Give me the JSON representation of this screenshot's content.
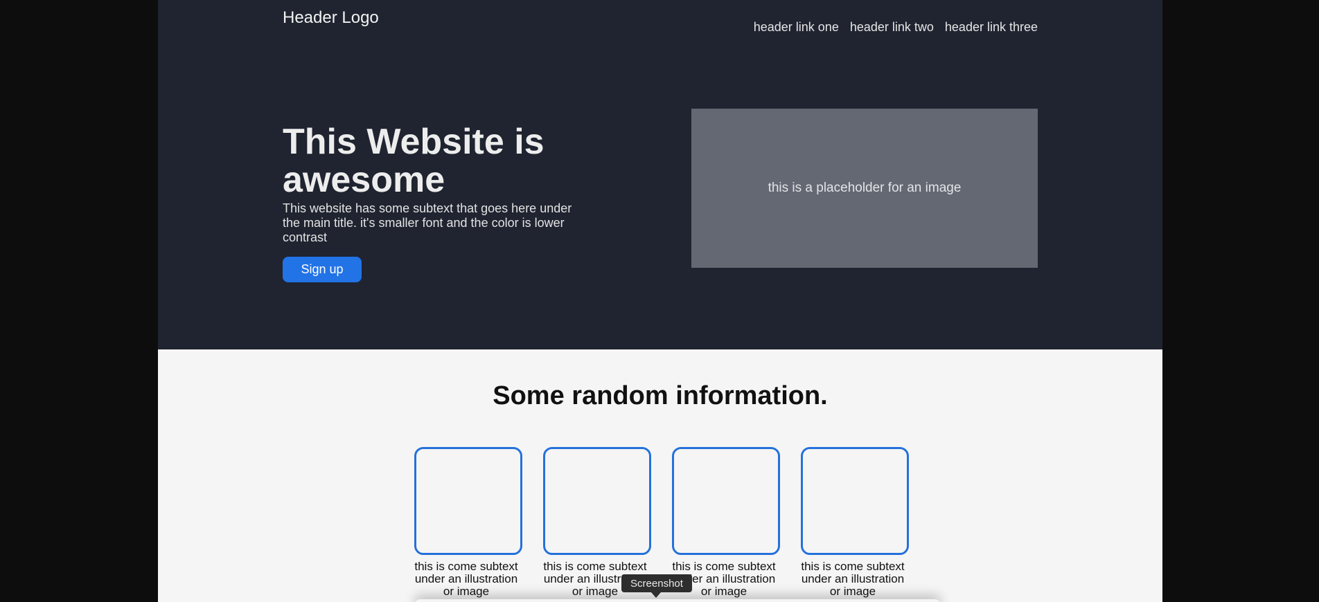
{
  "header": {
    "logo": "Header Logo",
    "links": [
      "header link one",
      "header link two",
      "header link three"
    ]
  },
  "hero": {
    "title": "This Website is awesome",
    "subtext": "This website has some subtext that goes here under the main title. it's smaller font and the color is lower contrast",
    "signup_label": "Sign up",
    "image_placeholder": "this is a placeholder for an image"
  },
  "info": {
    "heading": "Some random information.",
    "cards": [
      {
        "text": "this is come subtext under an illustration or image"
      },
      {
        "text": "this is come subtext under an illustration or image"
      },
      {
        "text": "this is come subtext under an illustration or image"
      },
      {
        "text": "this is come subtext under an illustration or image"
      }
    ]
  },
  "tooltip": "Screenshot",
  "colors": {
    "hero_bg": "#1f2430",
    "accent": "#2273e6",
    "card_border": "#2471db",
    "info_bg": "#f5f5f5"
  }
}
